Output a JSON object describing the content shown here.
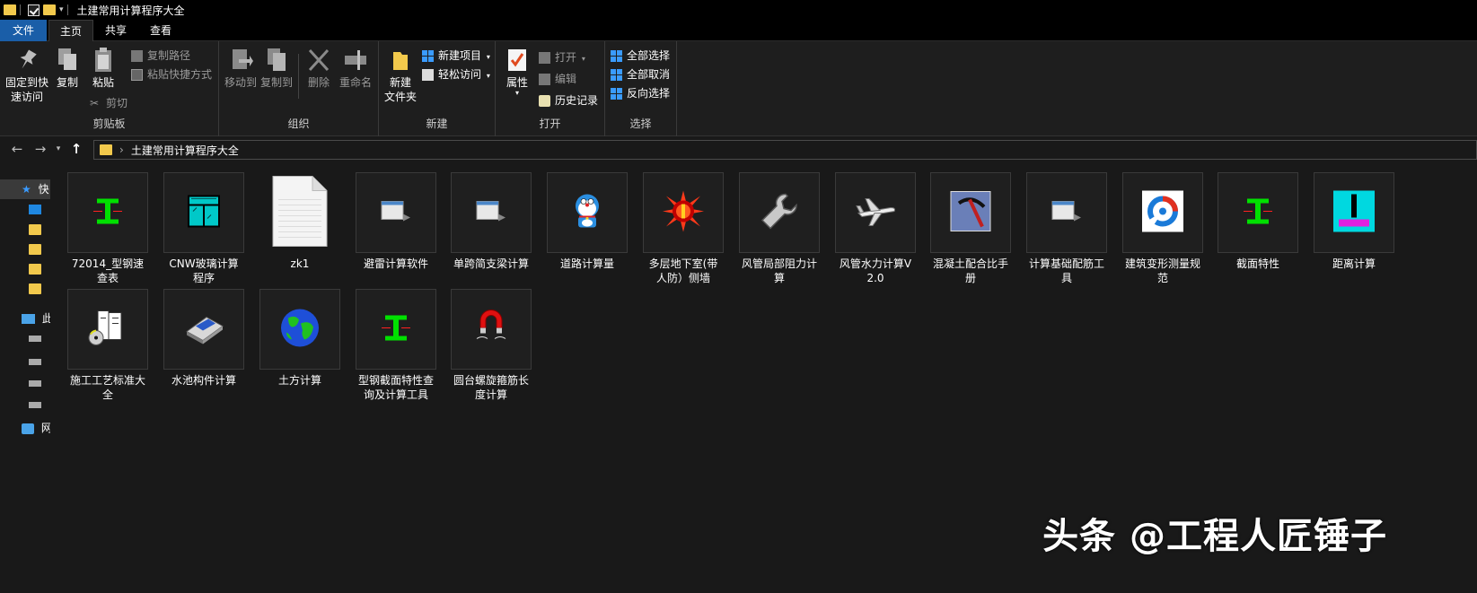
{
  "window": {
    "title": "土建常用计算程序大全"
  },
  "tabs": [
    "文件",
    "主页",
    "共享",
    "查看"
  ],
  "ribbon": {
    "clipboard": {
      "label": "剪贴板",
      "pin": "固定到快速访问",
      "pin_line1": "固定到快",
      "pin_line2": "速访问",
      "copy": "复制",
      "paste": "粘贴",
      "copy_path": "复制路径",
      "paste_shortcut": "粘贴快捷方式",
      "cut": "剪切"
    },
    "organize": {
      "label": "组织",
      "move_to": "移动到",
      "copy_to": "复制到",
      "delete": "删除",
      "rename": "重命名"
    },
    "new": {
      "label": "新建",
      "new_folder_line1": "新建",
      "new_folder_line2": "文件夹",
      "new_item": "新建项目",
      "easy_access": "轻松访问"
    },
    "open": {
      "label": "打开",
      "properties": "属性",
      "open": "打开",
      "edit": "编辑",
      "history": "历史记录"
    },
    "select": {
      "label": "选择",
      "select_all": "全部选择",
      "select_none": "全部取消",
      "invert": "反向选择"
    }
  },
  "address": {
    "path": "土建常用计算程序大全"
  },
  "sidebar": {
    "quick_access": "快",
    "this_pc": "此",
    "network": "网"
  },
  "files": [
    {
      "name": "72014_型钢速查表",
      "icon": "i-beam-icon"
    },
    {
      "name": "CNW玻璃计算程序",
      "icon": "glass-window-icon"
    },
    {
      "name": "zk1",
      "icon": "document-icon"
    },
    {
      "name": "避雷计算软件",
      "icon": "generic-exe-icon"
    },
    {
      "name": "单跨简支梁计算",
      "icon": "generic-exe-icon"
    },
    {
      "name": "道路计算量",
      "icon": "doraemon-icon"
    },
    {
      "name": "多层地下室(带人防）侧墙",
      "icon": "red-burst-icon"
    },
    {
      "name": "风管局部阻力计算",
      "icon": "wrench-icon"
    },
    {
      "name": "风管水力计算V2.0",
      "icon": "airplane-icon"
    },
    {
      "name": "混凝土配合比手册",
      "icon": "pickaxe-icon"
    },
    {
      "name": "计算基础配筋工具",
      "icon": "generic-exe-icon"
    },
    {
      "name": "建筑变形测量规范",
      "icon": "gear-logo-icon"
    },
    {
      "name": "截面特性",
      "icon": "i-beam-icon"
    },
    {
      "name": "距离计算",
      "icon": "distance-icon"
    },
    {
      "name": "施工工艺标准大全",
      "icon": "books-cd-icon"
    },
    {
      "name": "水池构件计算",
      "icon": "disk-drive-icon"
    },
    {
      "name": "土方计算",
      "icon": "globe-icon"
    },
    {
      "name": "型钢截面特性查询及计算工具",
      "icon": "i-beam-icon"
    },
    {
      "name": "圆台螺旋箍筋长度计算",
      "icon": "magnet-icon"
    }
  ],
  "watermark": "头条 @工程人匠锤子",
  "colors": {
    "accent": "#1a5ea8",
    "background": "#191919",
    "ibeam": "#00e000"
  }
}
